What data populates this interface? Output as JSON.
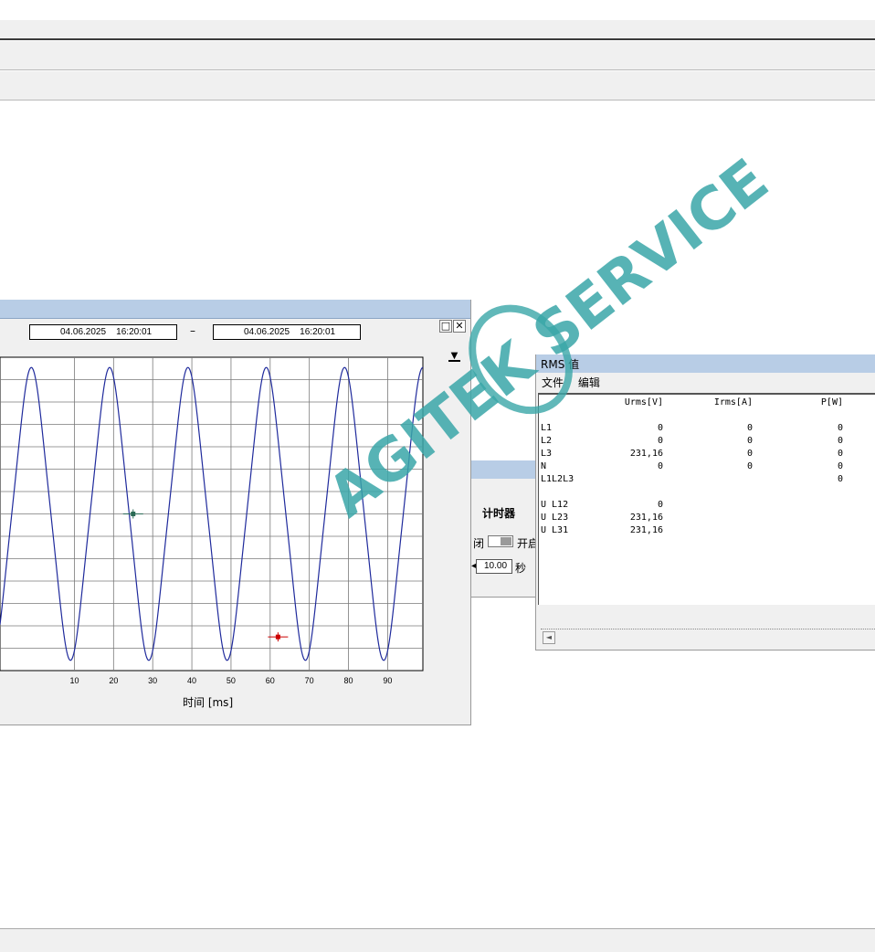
{
  "window": {
    "accent": "#b8cde6",
    "bar_bg": "#f0f0f0"
  },
  "oscilloscope": {
    "date_from": "04.06.2025    16:20:01",
    "date_to": "04.06.2025    16:20:01",
    "date_separator": "–",
    "restore_icon": "restore-window-icon",
    "close_icon": "close-window-icon",
    "dropdown_icon": "dropdown-arrow-icon",
    "restore_glyph": "□",
    "close_glyph": "✕",
    "dropdown_glyph": "▼",
    "x_axis_label": "时间 [ms]"
  },
  "chart_data": {
    "type": "line",
    "xlabel": "时间 [ms]",
    "ylabel": "",
    "xlim": [
      -9,
      99
    ],
    "ylim": [
      -1.07,
      1.07
    ],
    "x_ticks": [
      10,
      20,
      30,
      40,
      50,
      60,
      70,
      80,
      90
    ],
    "grid": true,
    "series": [
      {
        "color": "#1f2a9c",
        "frequency_hz": 50,
        "amplitude": 1.0,
        "peak_times_ms": [
          -1,
          9,
          19,
          29,
          39,
          49,
          59,
          69,
          79,
          89
        ]
      }
    ],
    "cursors": [
      {
        "x": 25,
        "y": 0.0,
        "color": "#2a6a55"
      },
      {
        "x": 62,
        "y": -0.84,
        "color": "#cc0000"
      }
    ]
  },
  "timer_panel": {
    "title": "计时器",
    "off_label": "闭",
    "on_label": "开启",
    "interval_value": "10.00",
    "unit_label": "秒"
  },
  "rms": {
    "title": "RMS 值",
    "menu": [
      "文件",
      "编辑"
    ],
    "headers": [
      "Urms[V]",
      "Irms[A]",
      "P[W]"
    ],
    "rows": [
      {
        "label": "L1",
        "u": "0",
        "i": "0",
        "p": "0"
      },
      {
        "label": "L2",
        "u": "0",
        "i": "0",
        "p": "0"
      },
      {
        "label": "L3",
        "u": "231,16",
        "i": "0",
        "p": "0"
      },
      {
        "label": "N",
        "u": "0",
        "i": "0",
        "p": "0"
      },
      {
        "label": "L1L2L3",
        "u": "",
        "i": "",
        "p": "0"
      }
    ],
    "line_rows": [
      {
        "label": "U L12",
        "u": "0"
      },
      {
        "label": "U L23",
        "u": "231,16"
      },
      {
        "label": "U L31",
        "u": "231,16"
      }
    ],
    "scroll_left_glyph": "◄"
  },
  "watermark": {
    "text": "AGITEK SERVICE",
    "color": "#3aa6a8"
  }
}
